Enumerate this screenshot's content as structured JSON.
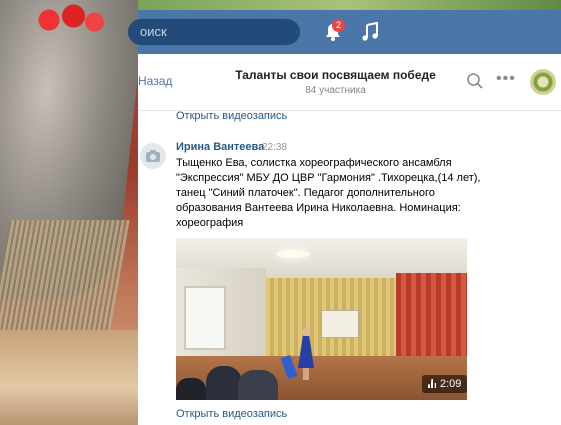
{
  "topbar": {
    "search_text": "оиск",
    "notifications_badge": "2"
  },
  "header": {
    "back_label": "Назад",
    "title": "Таланты свои посвящаем победе",
    "subtitle": "84 участника"
  },
  "feed": {
    "open_video_top": "Открыть видеозапись",
    "post": {
      "author": "Ирина Вантеева",
      "time": "22:38",
      "text": "Тыщенко Ева, солистка хореографического ансамбля \"Экспрессия\" МБУ ДО ЦВР \"Гармония\" .Тихорецка,(14 лет), танец \"Синий платочек\". Педагог дополнительного образования Вантеева Ирина Николаевна. Номинация: хореография",
      "video_duration": "2:09",
      "open_video_bottom": "Открыть видеозапись"
    }
  },
  "colors": {
    "topbar": "#4a76a8",
    "link": "#2a5885",
    "badge": "#e64646"
  },
  "icons": [
    "search-icon",
    "bell-icon",
    "music-icon",
    "more-icon",
    "camera-icon",
    "views-icon"
  ]
}
